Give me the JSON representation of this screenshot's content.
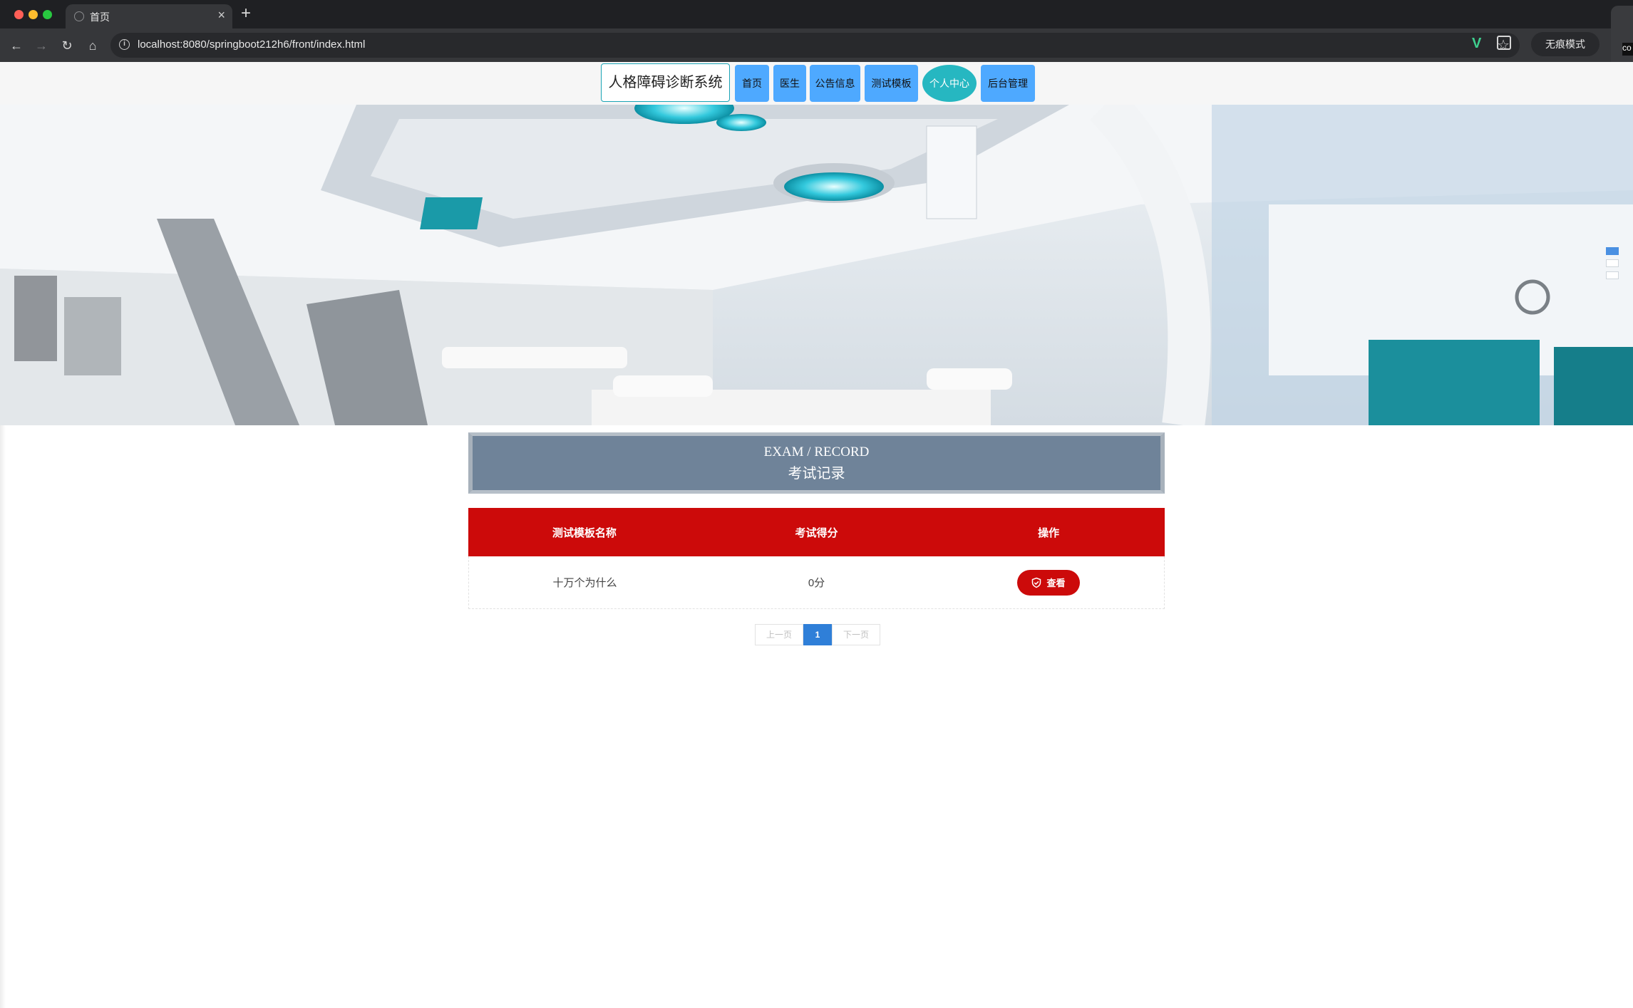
{
  "browser": {
    "tab_title": "首页",
    "url": "localhost:8080/springboot212h6/front/index.html",
    "incognito_label": "无痕模式",
    "side_widget_text": "co"
  },
  "site": {
    "title": "人格障碍诊断系统",
    "nav": [
      {
        "label": "首页"
      },
      {
        "label": "医生"
      },
      {
        "label": "公告信息"
      },
      {
        "label": "测试模板"
      },
      {
        "label": "个人中心",
        "active": true
      },
      {
        "label": "后台管理"
      }
    ]
  },
  "banner": {
    "slide_count": 3,
    "active_slide": 1
  },
  "section": {
    "title_en": "EXAM / RECORD",
    "title_cn": "考试记录"
  },
  "table": {
    "headers": [
      "测试模板名称",
      "考试得分",
      "操作"
    ],
    "rows": [
      {
        "name": "十万个为什么",
        "score": "0分",
        "action": "查看"
      }
    ]
  },
  "pagination": {
    "prev": "上一页",
    "current": "1",
    "next": "下一页"
  },
  "colors": {
    "nav_button": "#4ea9ff",
    "nav_active": "#26b7c1",
    "table_header": "#cc0a0a",
    "title_box": "#6f8399",
    "pager_current": "#2f7fd8"
  }
}
